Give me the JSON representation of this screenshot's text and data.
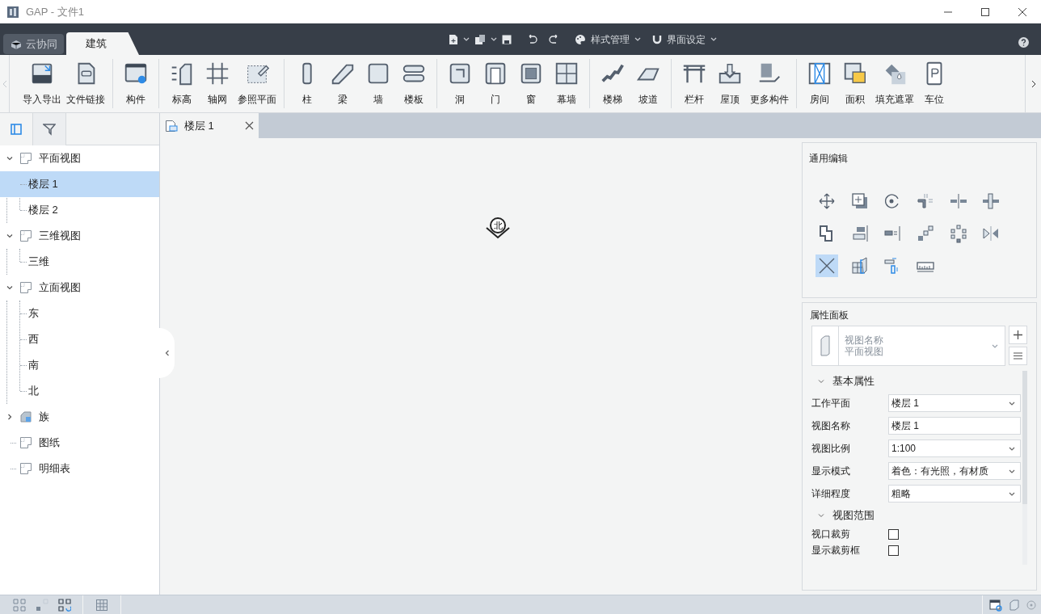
{
  "window": {
    "title": "GAP - 文件1"
  },
  "ribbon_tabs": [
    {
      "label": "云协同",
      "kind": "cloud",
      "selected": false
    },
    {
      "label": "建筑",
      "kind": "plain",
      "selected": true
    }
  ],
  "quick_menus": [
    {
      "label": "样式管理"
    },
    {
      "label": "界面设定"
    }
  ],
  "ribbon_groups": [
    {
      "tools": [
        {
          "label": "导入导出"
        },
        {
          "label": "文件链接"
        }
      ]
    },
    {
      "tools": [
        {
          "label": "构件"
        }
      ]
    },
    {
      "tools": [
        {
          "label": "标高"
        },
        {
          "label": "轴网"
        },
        {
          "label": "参照平面"
        }
      ]
    },
    {
      "tools": [
        {
          "label": "柱"
        },
        {
          "label": "梁"
        },
        {
          "label": "墙"
        },
        {
          "label": "楼板"
        }
      ]
    },
    {
      "tools": [
        {
          "label": "洞"
        },
        {
          "label": "门"
        },
        {
          "label": "窗"
        },
        {
          "label": "幕墙"
        }
      ]
    },
    {
      "tools": [
        {
          "label": "楼梯"
        },
        {
          "label": "坡道"
        }
      ]
    },
    {
      "tools": [
        {
          "label": "栏杆"
        },
        {
          "label": "屋顶"
        },
        {
          "label": "更多构件"
        }
      ]
    },
    {
      "tools": [
        {
          "label": "房间"
        },
        {
          "label": "面积"
        },
        {
          "label": "填充遮罩"
        },
        {
          "label": "车位"
        }
      ]
    }
  ],
  "sidebar": {
    "tabs": [
      {
        "selected": true
      },
      {
        "selected": false
      }
    ],
    "tree": [
      {
        "label": "平面视图",
        "kind": "view",
        "expanded": true,
        "selected": false,
        "children": [
          {
            "label": "楼层 1",
            "selected": true
          },
          {
            "label": "楼层 2",
            "selected": false
          }
        ]
      },
      {
        "label": "三维视图",
        "kind": "view",
        "expanded": true,
        "selected": false,
        "children": [
          {
            "label": "三维",
            "selected": false
          }
        ]
      },
      {
        "label": "立面视图",
        "kind": "view",
        "expanded": true,
        "selected": false,
        "children": [
          {
            "label": "东",
            "selected": false
          },
          {
            "label": "西",
            "selected": false
          },
          {
            "label": "南",
            "selected": false
          },
          {
            "label": "北",
            "selected": false
          }
        ]
      },
      {
        "label": "族",
        "kind": "family",
        "expanded": false,
        "selected": false
      },
      {
        "label": "图纸",
        "kind": "view",
        "selected": false
      },
      {
        "label": "明细表",
        "kind": "view",
        "selected": false
      }
    ]
  },
  "document_tabs": [
    {
      "label": "楼层 1",
      "selected": true
    }
  ],
  "canvas": {
    "north_label": "北"
  },
  "edit_panel": {
    "title": "通用编辑",
    "tools": [
      {
        "selected": false
      },
      {
        "selected": false
      },
      {
        "selected": false
      },
      {
        "selected": false
      },
      {
        "selected": false
      },
      {
        "selected": false
      },
      {
        "selected": false
      },
      {
        "selected": false
      },
      {
        "selected": false
      },
      {
        "selected": false
      },
      {
        "selected": false
      },
      {
        "selected": false
      },
      {
        "selected": true
      },
      {
        "selected": false
      },
      {
        "selected": false
      },
      {
        "selected": false
      }
    ]
  },
  "properties": {
    "title": "属性面板",
    "type_selector": {
      "line_1": "视图名称",
      "line_2": "平面视图"
    },
    "sections": [
      {
        "title": "基本属性",
        "expanded": true,
        "rows": [
          {
            "label": "工作平面",
            "kind": "select",
            "value": "楼层 1"
          },
          {
            "label": "视图名称",
            "kind": "text",
            "value": "楼层 1"
          },
          {
            "label": "视图比例",
            "kind": "select",
            "value": "1:100"
          },
          {
            "label": "显示模式",
            "kind": "select",
            "value": "着色：有光照，有材质"
          },
          {
            "label": "详细程度",
            "kind": "select",
            "value": "粗略"
          }
        ]
      },
      {
        "title": "视图范围",
        "expanded": true,
        "rows": [
          {
            "label": "视口裁剪",
            "kind": "checkbox",
            "checked": false
          },
          {
            "label": "显示裁剪框",
            "kind": "checkbox",
            "checked": false
          }
        ]
      }
    ]
  }
}
